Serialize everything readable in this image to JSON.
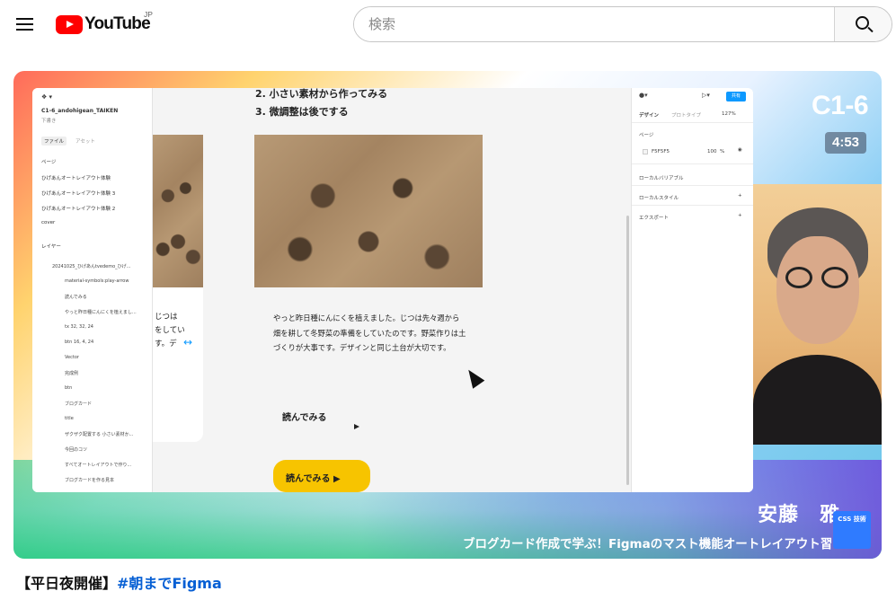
{
  "header": {
    "logo_text": "YouTube",
    "region": "JP",
    "search_placeholder": "検索"
  },
  "video": {
    "code": "C1-6",
    "duration": "4:53",
    "presenter_name": "安藤　雅一",
    "subtitle": "ブログカード作成で学ぶ！Figmaのマスト機能オートレイアウト習",
    "badge": "CSS 技術",
    "title_prefix": "【平日夜開催】",
    "title_hashtag": "#朝までFigma"
  },
  "figma": {
    "file_name": "C1-6_andohigean_TAIKEN",
    "file_sub": "下書き",
    "tab_file": "ファイル",
    "tab_assets": "アセット",
    "pages_label": "ページ",
    "pages": [
      "ひげあんオートレイアウト体験",
      "ひげあんオートレイアウト体験 3",
      "ひげあんオートレイアウト体験 2",
      "cover"
    ],
    "layers_label": "レイヤー",
    "layers": [
      "20241025_ひげあんtvedemo_ひげ...",
      "material-symbols:play-arrow",
      "読んでみる",
      "やっと昨日種にんにくを植えまし...",
      "tx 32, 32, 24",
      "btn 16, 4, 24",
      "Vector",
      "完成例",
      "btn",
      "ブログカード",
      "title",
      "ザクザク配置する 小さい素材か...",
      "今回のコツ",
      "すべてオートレイアウトで作り...",
      "ブログカードを作る見本"
    ],
    "right_tab_design": "デザイン",
    "right_tab_proto": "プロトタイプ",
    "zoom": "127%",
    "share": "共有",
    "right_page_label": "ページ",
    "bg_color": "F5F5F5",
    "bg_opacity": "100",
    "bg_percent": "%",
    "local_vars": "ローカルバリアブル",
    "local_styles": "ローカルスタイル",
    "export": "エクスポート",
    "canvas_step2": "2. 小さい素材から作ってみる",
    "canvas_step3": "3. 微調整は後でする",
    "card_left_lines": [
      "じつは",
      "をしてい",
      "す。デ"
    ],
    "article_text": "やっと昨日種にんにくを植えました。じつは先々週から畑を耕して冬野菜の準備をしていたのです。野菜作りは土づくりが大事です。デザインと同じ土台が大切です。",
    "readmore": "読んでみる",
    "readmore_btn": "読んでみる ▶"
  }
}
